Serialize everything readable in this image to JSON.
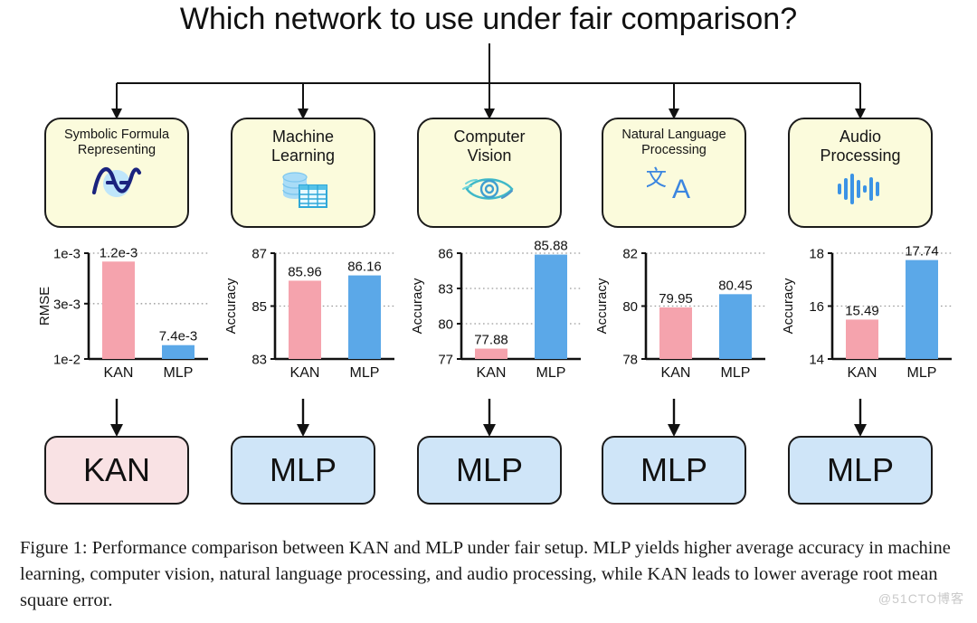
{
  "title": "Which network to use under fair comparison?",
  "categories": [
    {
      "label": "Symbolic Formula\nRepresenting",
      "size": "small",
      "icon": "sine-wave-icon"
    },
    {
      "label": "Machine\nLearning",
      "size": "big",
      "icon": "database-table-icon"
    },
    {
      "label": "Computer\nVision",
      "size": "big",
      "icon": "eye-icon"
    },
    {
      "label": "Natural Language\nProcessing",
      "size": "small",
      "icon": "translate-icon"
    },
    {
      "label": "Audio\nProcessing",
      "size": "big",
      "icon": "waveform-icon"
    }
  ],
  "results": [
    {
      "label": "KAN",
      "variant": "kan"
    },
    {
      "label": "MLP",
      "variant": "mlp"
    },
    {
      "label": "MLP",
      "variant": "mlp"
    },
    {
      "label": "MLP",
      "variant": "mlp"
    },
    {
      "label": "MLP",
      "variant": "mlp"
    }
  ],
  "colors": {
    "bar_kan": "#F5A3AD",
    "bar_mlp": "#5BA8E8",
    "box_fill": "#FBFBDC",
    "res_kan": "#F9E2E4",
    "res_mlp": "#CFE5F8",
    "axis": "#111111",
    "grid": "#9a9a9a"
  },
  "caption": "Figure 1: Performance comparison between KAN and MLP under fair setup.  MLP yields higher average accuracy in machine learning, computer vision, natural language processing, and audio processing, while KAN leads to lower average root mean square error.",
  "watermark": "@51CTO博客",
  "chart_data": [
    {
      "type": "bar",
      "title": "Symbolic Formula Representing",
      "ylabel": "RMSE",
      "xlabel": "",
      "categories": [
        "KAN",
        "MLP"
      ],
      "values": [
        0.0012,
        0.0074
      ],
      "labels": [
        "1.2e-3",
        "7.4e-3"
      ],
      "tick_labels": [
        "1e-3",
        "3e-3",
        "1e-2"
      ],
      "tick_values": [
        0.001,
        0.003,
        0.01
      ],
      "ylim": [
        0.001,
        0.01
      ],
      "inverted_axis": true,
      "grid": true,
      "legend": "none",
      "colors": [
        "#F5A3AD",
        "#5BA8E8"
      ]
    },
    {
      "type": "bar",
      "title": "Machine Learning",
      "ylabel": "Accuracy",
      "xlabel": "",
      "categories": [
        "KAN",
        "MLP"
      ],
      "values": [
        85.96,
        86.16
      ],
      "labels": [
        "85.96",
        "86.16"
      ],
      "tick_labels": [
        "83",
        "85",
        "87"
      ],
      "tick_values": [
        83,
        85,
        87
      ],
      "ylim": [
        83,
        87
      ],
      "inverted_axis": false,
      "grid": true,
      "legend": "none",
      "colors": [
        "#F5A3AD",
        "#5BA8E8"
      ]
    },
    {
      "type": "bar",
      "title": "Computer Vision",
      "ylabel": "Accuracy",
      "xlabel": "",
      "categories": [
        "KAN",
        "MLP"
      ],
      "values": [
        77.88,
        85.88
      ],
      "labels": [
        "77.88",
        "85.88"
      ],
      "tick_labels": [
        "77",
        "80",
        "83",
        "86"
      ],
      "tick_values": [
        77,
        80,
        83,
        86
      ],
      "ylim": [
        77,
        86
      ],
      "inverted_axis": false,
      "grid": true,
      "legend": "none",
      "colors": [
        "#F5A3AD",
        "#5BA8E8"
      ]
    },
    {
      "type": "bar",
      "title": "Natural Language Processing",
      "ylabel": "Accuracy",
      "xlabel": "",
      "categories": [
        "KAN",
        "MLP"
      ],
      "values": [
        79.95,
        80.45
      ],
      "labels": [
        "79.95",
        "80.45"
      ],
      "tick_labels": [
        "78",
        "80",
        "82"
      ],
      "tick_values": [
        78,
        80,
        82
      ],
      "ylim": [
        78,
        82
      ],
      "inverted_axis": false,
      "grid": true,
      "legend": "none",
      "colors": [
        "#F5A3AD",
        "#5BA8E8"
      ]
    },
    {
      "type": "bar",
      "title": "Audio Processing",
      "ylabel": "Accuracy",
      "xlabel": "",
      "categories": [
        "KAN",
        "MLP"
      ],
      "values": [
        15.49,
        17.74
      ],
      "labels": [
        "15.49",
        "17.74"
      ],
      "tick_labels": [
        "14",
        "16",
        "18"
      ],
      "tick_values": [
        14,
        16,
        18
      ],
      "ylim": [
        14,
        18
      ],
      "inverted_axis": false,
      "grid": true,
      "legend": "none",
      "colors": [
        "#F5A3AD",
        "#5BA8E8"
      ]
    }
  ]
}
